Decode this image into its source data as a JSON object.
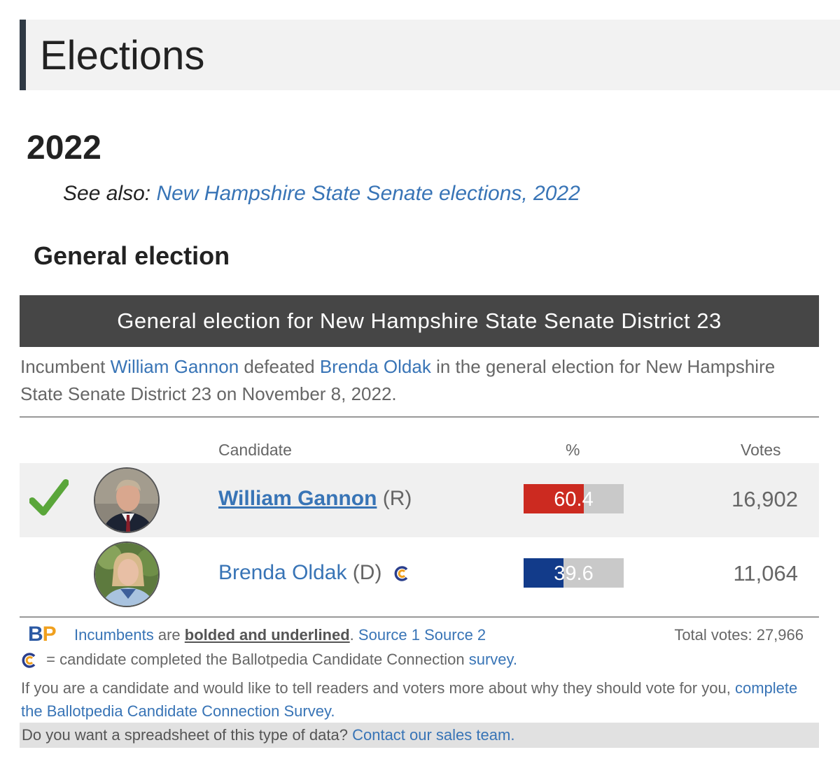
{
  "section": {
    "title": "Elections"
  },
  "year": "2022",
  "see_also": {
    "prefix": "See also:",
    "link": "New Hampshire State Senate elections, 2022"
  },
  "subheading": "General election",
  "race": {
    "title": "General election for New Hampshire State Senate District 23",
    "summary": {
      "incumbent_word": "Incumbent",
      "winner": "William Gannon",
      "defeated": "defeated",
      "loser": "Brenda Oldak",
      "rest": "in the general election for New Hampshire State Senate District 23 on November 8, 2022."
    }
  },
  "table": {
    "headers": {
      "candidate": "Candidate",
      "percent": "%",
      "votes": "Votes"
    },
    "rows": [
      {
        "name": "William Gannon",
        "party": "(R)",
        "percent": "60.4",
        "percent_value": 60.4,
        "votes": "16,902",
        "bar_color": "#cc2a20",
        "winner": true,
        "incumbent": true
      },
      {
        "name": "Brenda Oldak",
        "party": "(D)",
        "percent": "39.6",
        "percent_value": 39.6,
        "votes": "11,064",
        "bar_color": "#123b8a",
        "winner": false,
        "incumbent": false
      }
    ]
  },
  "footer": {
    "logo_b": "B",
    "logo_p": "P",
    "incumbents_link": "Incumbents",
    "are": "are",
    "bold_text": "bolded and underlined",
    "period": ".",
    "source1": "Source 1",
    "source2": "Source 2",
    "total_votes": "Total votes: 27,966",
    "cc_note": "= candidate completed the Ballotpedia Candidate Connection",
    "survey_link": "survey.",
    "candidate_note": "If you are a candidate and would like to tell readers and voters more about why they should vote for you,",
    "survey_long_link": "complete the Ballotpedia Candidate Connection Survey.",
    "spreadsheet_q": "Do you want a spreadsheet of this type of data?",
    "sales_link": "Contact our sales team."
  },
  "colors": {
    "link": "#3874b6",
    "header_bar": "#464646",
    "winner_check": "#5aa63a"
  },
  "icons": [
    "checkmark-icon",
    "candidate-connection-icon",
    "ballotpedia-logo"
  ]
}
